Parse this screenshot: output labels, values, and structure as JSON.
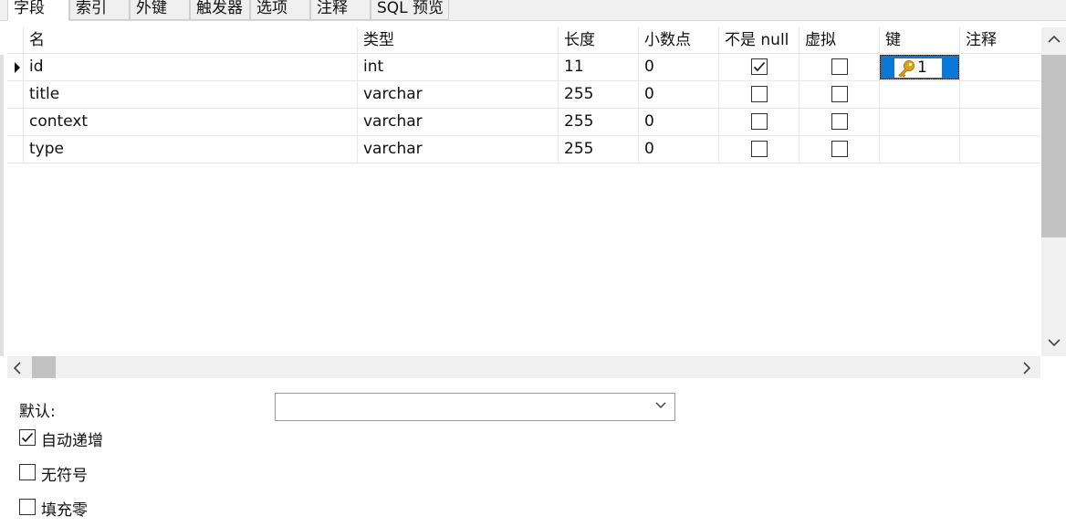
{
  "tabs": [
    "字段",
    "索引",
    "外键",
    "触发器",
    "选项",
    "注释",
    "SQL 预览"
  ],
  "columns": [
    "名",
    "类型",
    "长度",
    "小数点",
    "不是 null",
    "虚拟",
    "键",
    "注释"
  ],
  "rows": [
    {
      "name": "id",
      "type": "int",
      "length": "11",
      "decimals": "0",
      "not_null": true,
      "virtual": false,
      "key": "1",
      "comment": ""
    },
    {
      "name": "title",
      "type": "varchar",
      "length": "255",
      "decimals": "0",
      "not_null": false,
      "virtual": false,
      "key": "",
      "comment": ""
    },
    {
      "name": "context",
      "type": "varchar",
      "length": "255",
      "decimals": "0",
      "not_null": false,
      "virtual": false,
      "key": "",
      "comment": ""
    },
    {
      "name": "type",
      "type": "varchar",
      "length": "255",
      "decimals": "0",
      "not_null": false,
      "virtual": false,
      "key": "",
      "comment": ""
    }
  ],
  "bottom": {
    "default_label": "默认:",
    "default_value": "",
    "auto_increment_label": "自动递增",
    "auto_increment": true,
    "unsigned_label": "无符号",
    "unsigned": false,
    "zerofill_label": "填充零",
    "zerofill": false
  },
  "icons": {
    "key": "key-icon",
    "scroll_up": "chevron-up-icon",
    "scroll_down": "chevron-down-icon",
    "scroll_left": "chevron-left-icon",
    "scroll_right": "chevron-right-icon"
  },
  "colors": {
    "selection": "#0a78d7",
    "key_icon": "#e0a21a"
  }
}
